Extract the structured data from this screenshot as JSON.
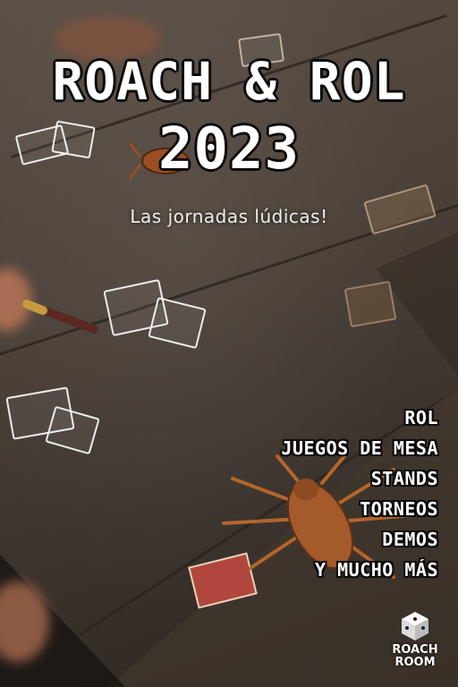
{
  "poster": {
    "title_line1": "ROACH & ROL",
    "title_line2": "2023",
    "subtitle": "Las jornadas lúdicas!",
    "activities": [
      "ROL",
      "JUEGOS DE MESA",
      "STANDS",
      "TORNEOS",
      "DEMOS",
      "Y MUCHO MÁS"
    ],
    "logo": {
      "line1": "ROACH",
      "line2": "ROOM",
      "icon": "dice-icon"
    }
  },
  "colors": {
    "text": "#ffffff",
    "outline": "#0d0b0a",
    "wood_light": "#5b5047",
    "wood_dark": "#2b241f",
    "roach": "#b5652a"
  }
}
